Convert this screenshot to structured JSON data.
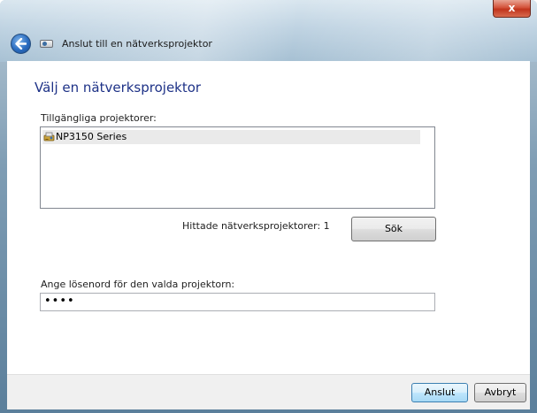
{
  "window": {
    "title": "Anslut till en nätverksprojektor",
    "close_symbol": "x",
    "icons": [
      "back-arrow-icon",
      "projector-wizard-icon",
      "close-icon"
    ]
  },
  "main": {
    "heading": "Välj en nätverksprojektor",
    "available_label": "Tillgängliga projektorer:",
    "projectors": [
      {
        "name": "NP3150 Series",
        "icon": "projector-lock-icon",
        "selected": true
      }
    ],
    "found_text": "Hittade nätverksprojektorer: 1",
    "search_button": "Sök",
    "password_label": "Ange lösenord för den valda projektorn:",
    "password_value": "••••"
  },
  "footer": {
    "connect_button": "Anslut",
    "cancel_button": "Avbryt"
  },
  "colors": {
    "heading": "#1e3287",
    "selection": "#eaeaea",
    "accent_button_border": "#3c7fb1"
  }
}
